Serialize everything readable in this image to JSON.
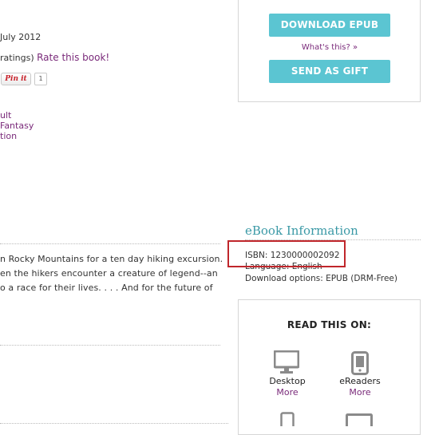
{
  "book": {
    "pub_date": "July 2012",
    "rating_prefix": "ratings)",
    "rate_link": "Rate this book!",
    "pinit_label": "Pin it",
    "pin_count": "1",
    "categories": [
      "ult",
      "Fantasy",
      "tion"
    ]
  },
  "description": {
    "line1": "n Rocky Mountains for a ten day hiking excursion.",
    "line2": "en the hikers encounter a creature of legend--an",
    "line3": "o a race for their lives. . . . And for the future of"
  },
  "purchase": {
    "download_label": "DOWNLOAD EPUB",
    "whats_this": "What's this? »",
    "gift_label": "SEND AS GIFT"
  },
  "ebook_info": {
    "heading": "eBook Information",
    "isbn": "ISBN: 1230000002092",
    "language": "Language: English",
    "download_options": "Download options: EPUB (DRM-Free)"
  },
  "read_on": {
    "heading": "READ THIS ON:",
    "devices": [
      {
        "label": "Desktop",
        "more": "More",
        "icon": "desktop-icon"
      },
      {
        "label": "eReaders",
        "more": "More",
        "icon": "ereader-icon"
      }
    ]
  },
  "colors": {
    "accent_teal": "#5bc5d2",
    "heading_teal": "#3a99a6",
    "link_purple": "#7a2a7a",
    "highlight_red": "#c0262b"
  }
}
